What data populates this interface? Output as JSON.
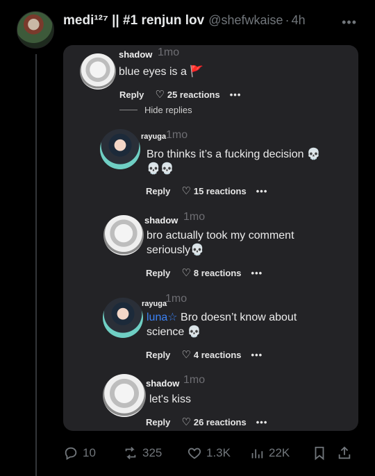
{
  "post": {
    "display_name": "medi¹²⁷ || #1 renjun lov",
    "handle": "@shefwkaise",
    "time": "4h",
    "dot": "·"
  },
  "embed": {
    "comments": [
      {
        "username": "shadow",
        "time": "1mo",
        "text": "blue eyes is a 🚩",
        "reply_label": "Reply",
        "reactions": "25 reactions",
        "hide_replies": "Hide replies"
      },
      {
        "username": "rayuga",
        "time": "1mo",
        "text_line1": "Bro thinks it’s a fucking decision 💀",
        "text_line2": "💀💀",
        "reply_label": "Reply",
        "reactions": "15 reactions"
      },
      {
        "username": "shadow",
        "time": "1mo",
        "text_line1": "bro actually took my comment",
        "text_line2": "seriously💀",
        "reply_label": "Reply",
        "reactions": "8 reactions"
      },
      {
        "username": "rayuga",
        "time": "1mo",
        "mention": "luna☆",
        "text_line1": " Bro doesn’t know about",
        "text_line2": "science 💀",
        "reply_label": "Reply",
        "reactions": "4 reactions"
      },
      {
        "username": "shadow",
        "time": "1mo",
        "text": "let's kiss",
        "reply_label": "Reply",
        "reactions": "26 reactions"
      }
    ]
  },
  "toolbar": {
    "replies": "10",
    "reposts": "325",
    "likes": "1.3K",
    "views": "22K"
  }
}
